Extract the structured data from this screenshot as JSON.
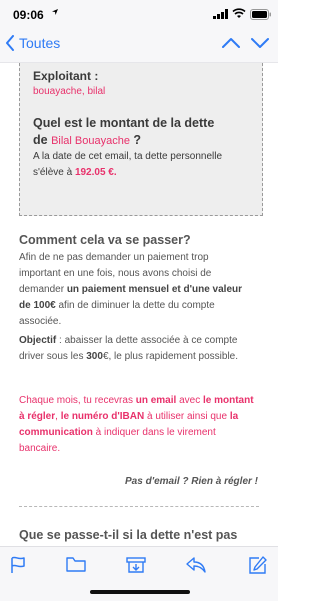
{
  "status_bar": {
    "time": "09:06"
  },
  "nav": {
    "back_label": "Toutes"
  },
  "email": {
    "exploitant_label": "Exploitant :",
    "exploitant_value": "bouayache, bilal",
    "question_line1": "Quel est le montant de la dette",
    "question_line2_prefix": "de ",
    "question_name": "Bilal Bouayache",
    "question_suffix": " ?",
    "debt_line1": "A la date de cet email, ta dette personnelle",
    "debt_line2_prefix": "s'élève à ",
    "debt_amount": "192.05 €.",
    "section1_title": "Comment cela va se passer?",
    "p1_line1": "Afin de ne pas demander un paiement trop",
    "p1_line2": "important en une fois, nous avons choisi de",
    "p1_line3_prefix": "demander ",
    "p1_line3_bold": "un paiement mensuel et d'une valeur",
    "p1_line4_bold": "de 100€",
    "p1_line4_suffix": " afin de diminuer la dette du compte",
    "p1_line5": "associée.",
    "p2_line1_bold": "Objectif",
    "p2_line1_suffix": " : abaisser la dette associée à ce compte",
    "p2_line2_prefix": "driver sous les ",
    "p2_line2_bold": "300",
    "p2_line2_suffix": "€, le plus rapidement possible.",
    "p3_line1_prefix": "Chaque mois, tu recevras ",
    "p3_line1_b1": "un email",
    "p3_line1_mid": " avec ",
    "p3_line1_b2": "le montant",
    "p3_line2_b1": "à régler",
    "p3_line2_mid1": ", ",
    "p3_line2_b2": "le numéro d'IBAN",
    "p3_line2_mid2": " à utiliser ainsi que ",
    "p3_line2_b3": "la",
    "p3_line3_b1": "communication",
    "p3_line3_suffix": " à indiquer dans le virement",
    "p3_line4": "bancaire.",
    "no_email_note": "Pas d'email ? Rien à régler !",
    "section2_title": "Que se passe-t-il si la dette n'est pas"
  },
  "colors": {
    "accent": "#2f7bf5",
    "highlight": "#e8316b"
  },
  "toolbar": {
    "icons": [
      "flag-icon",
      "folder-icon",
      "archive-icon",
      "reply-icon",
      "compose-icon"
    ]
  }
}
